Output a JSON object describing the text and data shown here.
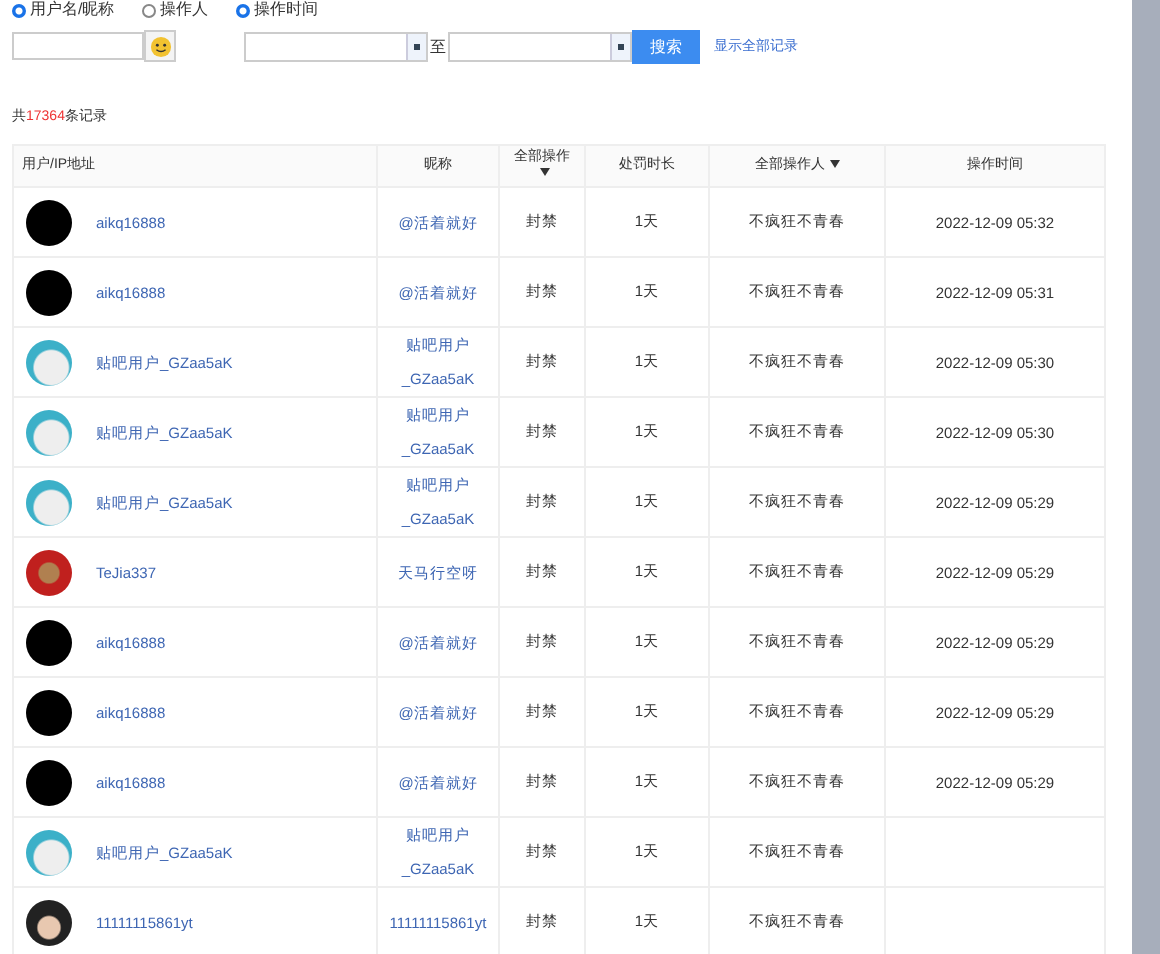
{
  "filters": {
    "radios": [
      {
        "label": "用户名/昵称",
        "selected": true
      },
      {
        "label": "操作人",
        "selected": false
      },
      {
        "label": "操作时间",
        "selected": true
      }
    ],
    "date_separator": "至",
    "search_button": "搜索",
    "show_all_link": "显示全部记录"
  },
  "summary_prefix": "共",
  "summary_count": "17364",
  "summary_suffix": "条记录",
  "table": {
    "columns": [
      {
        "label": "用户/IP地址",
        "dropdown": false
      },
      {
        "label": "昵称",
        "dropdown": false
      },
      {
        "label": "全部操作",
        "dropdown": true
      },
      {
        "label": "处罚时长",
        "dropdown": false
      },
      {
        "label": "全部操作人",
        "dropdown": true
      },
      {
        "label": "操作时间",
        "dropdown": false
      }
    ],
    "rows": [
      {
        "kind": "black",
        "user": "aikq16888",
        "nickname": "@活着就好",
        "action": "封禁",
        "duration": "1天",
        "operator": "不疯狂不青春",
        "time": "2022-12-09 05:32"
      },
      {
        "kind": "black",
        "user": "aikq16888",
        "nickname": "@活着就好",
        "action": "封禁",
        "duration": "1天",
        "operator": "不疯狂不青春",
        "time": "2022-12-09 05:31"
      },
      {
        "kind": "cat",
        "user": "贴吧用户_GZaa5aK",
        "nickname": "贴吧用户_GZaa5aK",
        "action": "封禁",
        "duration": "1天",
        "operator": "不疯狂不青春",
        "time": "2022-12-09 05:30"
      },
      {
        "kind": "cat",
        "user": "贴吧用户_GZaa5aK",
        "nickname": "贴吧用户_GZaa5aK",
        "action": "封禁",
        "duration": "1天",
        "operator": "不疯狂不青春",
        "time": "2022-12-09 05:30"
      },
      {
        "kind": "cat",
        "user": "贴吧用户_GZaa5aK",
        "nickname": "贴吧用户_GZaa5aK",
        "action": "封禁",
        "duration": "1天",
        "operator": "不疯狂不青春",
        "time": "2022-12-09 05:29"
      },
      {
        "kind": "red",
        "user": "TeJia337",
        "nickname": "天马行空呀",
        "action": "封禁",
        "duration": "1天",
        "operator": "不疯狂不青春",
        "time": "2022-12-09 05:29"
      },
      {
        "kind": "black",
        "user": "aikq16888",
        "nickname": "@活着就好",
        "action": "封禁",
        "duration": "1天",
        "operator": "不疯狂不青春",
        "time": "2022-12-09 05:29"
      },
      {
        "kind": "black",
        "user": "aikq16888",
        "nickname": "@活着就好",
        "action": "封禁",
        "duration": "1天",
        "operator": "不疯狂不青春",
        "time": "2022-12-09 05:29"
      },
      {
        "kind": "black",
        "user": "aikq16888",
        "nickname": "@活着就好",
        "action": "封禁",
        "duration": "1天",
        "operator": "不疯狂不青春",
        "time": "2022-12-09 05:29"
      },
      {
        "kind": "cat",
        "user": "贴吧用户_GZaa5aK",
        "nickname": "贴吧用户_GZaa5aK",
        "action": "封禁",
        "duration": "1天",
        "operator": "不疯狂不青春"
      },
      {
        "kind": "person",
        "user": "11111115861yt",
        "nickname": "11111115861yt",
        "action": "封禁",
        "duration": "1天",
        "operator": "不疯狂不青春"
      }
    ]
  }
}
